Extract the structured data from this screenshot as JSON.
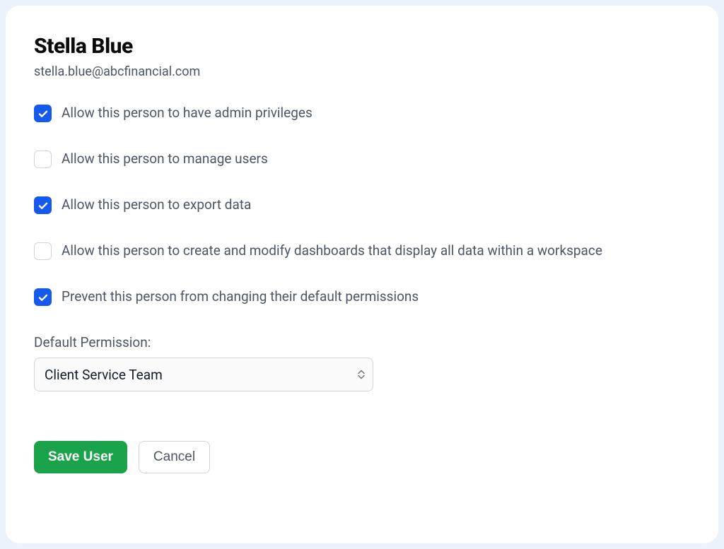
{
  "user": {
    "name": "Stella Blue",
    "email": "stella.blue@abcfinancial.com"
  },
  "permissions": [
    {
      "label": "Allow this person to have admin privileges",
      "checked": true
    },
    {
      "label": "Allow this person to manage users",
      "checked": false
    },
    {
      "label": "Allow this person to export data",
      "checked": true
    },
    {
      "label": "Allow this person to create and modify dashboards that display all data within a workspace",
      "checked": false
    },
    {
      "label": "Prevent this person from changing their default permissions",
      "checked": true
    }
  ],
  "default_permission": {
    "label": "Default Permission:",
    "value": "Client Service Team"
  },
  "buttons": {
    "save": "Save User",
    "cancel": "Cancel"
  }
}
